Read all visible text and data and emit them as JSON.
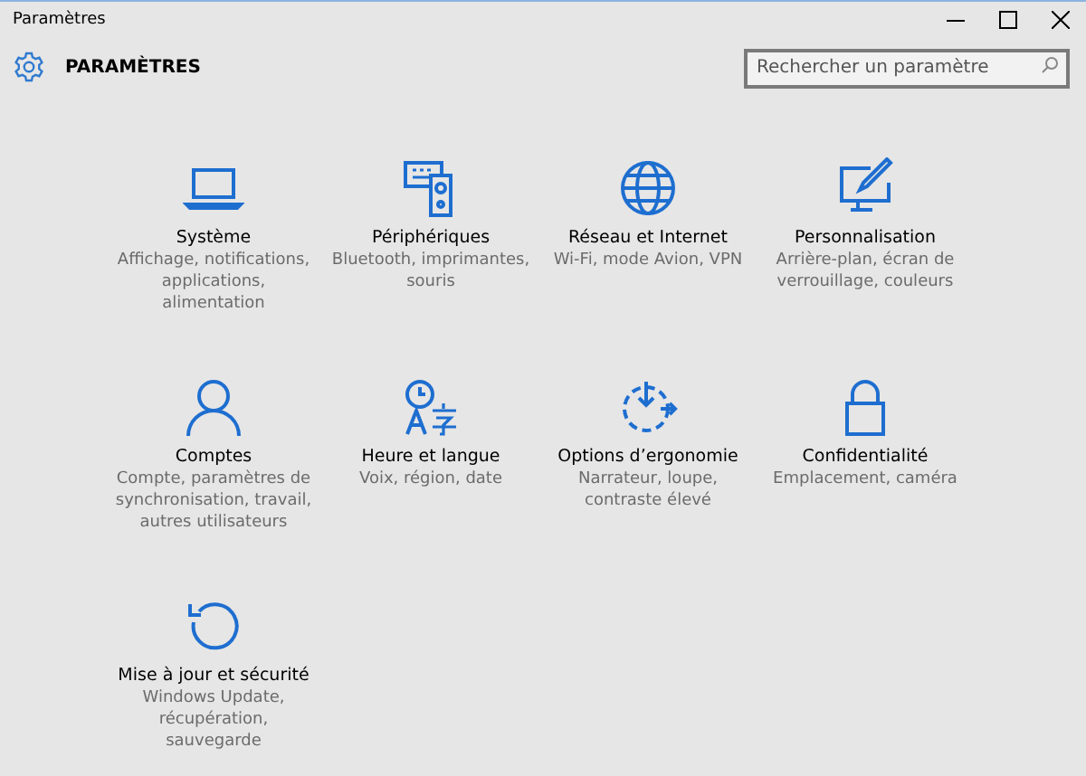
{
  "window": {
    "title": "Paramètres"
  },
  "header": {
    "title": "PARAMÈTRES"
  },
  "search": {
    "placeholder": "Rechercher un paramètre"
  },
  "tiles": [
    {
      "kind": "laptop",
      "title": "Système",
      "description": "Affichage, notifications,\napplications,\nalimentation"
    },
    {
      "kind": "devices",
      "title": "Périphériques",
      "description": "Bluetooth, imprimantes,\nsouris"
    },
    {
      "kind": "globe",
      "title": "Réseau et Internet",
      "description": "Wi-Fi, mode Avion, VPN"
    },
    {
      "kind": "brush",
      "title": "Personnalisation",
      "description": "Arrière-plan, écran de\nverrouillage, couleurs"
    },
    {
      "kind": "person",
      "title": "Comptes",
      "description": "Compte, paramètres de\nsynchronisation, travail,\nautres utilisateurs"
    },
    {
      "kind": "time-language",
      "title": "Heure et langue",
      "description": "Voix, région, date"
    },
    {
      "kind": "ease",
      "title": "Options d’ergonomie",
      "description": "Narrateur, loupe,\ncontraste élevé"
    },
    {
      "kind": "lock",
      "title": "Confidentialité",
      "description": "Emplacement, caméra"
    },
    {
      "kind": "update",
      "title": "Mise à jour et sécurité",
      "description": "Windows Update,\nrécupération,\nsauvegarde"
    }
  ]
}
